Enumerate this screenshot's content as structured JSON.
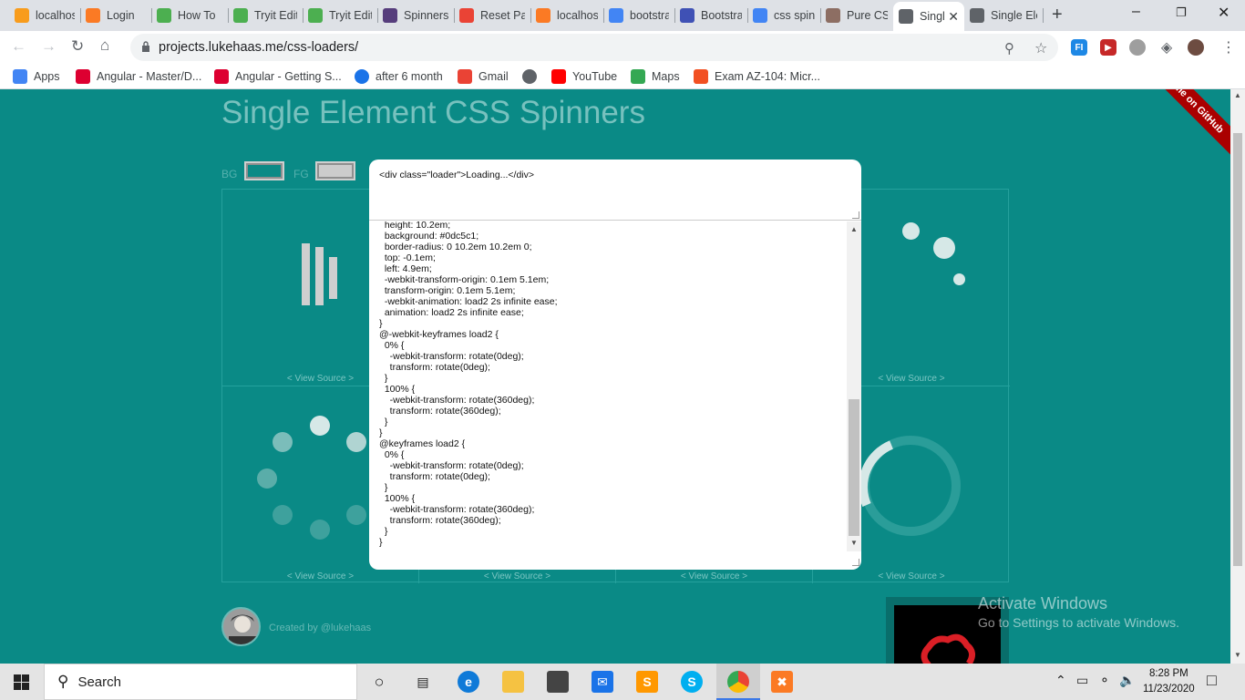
{
  "browser": {
    "tabs": [
      {
        "title": "localhost",
        "icon": "phpmyadmin-icon",
        "color": "#f89c1c"
      },
      {
        "title": "Login",
        "icon": "xampp-icon",
        "color": "#fb7a24"
      },
      {
        "title": "How To",
        "icon": "w3schools-icon",
        "color": "#4caf50"
      },
      {
        "title": "Tryit Editor",
        "icon": "w3schools-icon",
        "color": "#4caf50"
      },
      {
        "title": "Tryit Editor",
        "icon": "w3schools-icon",
        "color": "#4caf50"
      },
      {
        "title": "Spinners",
        "icon": "bootstrap-icon",
        "color": "#563d7c"
      },
      {
        "title": "Reset Password",
        "icon": "gmail-icon",
        "color": "#ea4335"
      },
      {
        "title": "localhost",
        "icon": "xampp-icon",
        "color": "#fb7a24"
      },
      {
        "title": "bootstrap",
        "icon": "google-icon",
        "color": "#4285f4"
      },
      {
        "title": "Bootstrap",
        "icon": "mdb-icon",
        "color": "#3f51b5"
      },
      {
        "title": "css spinner",
        "icon": "google-icon",
        "color": "#4285f4"
      },
      {
        "title": "Pure CSS",
        "icon": "codepen-icon",
        "color": "#8d6e63"
      },
      {
        "title": "Single",
        "icon": "globe-icon",
        "color": "#5f6368",
        "active": true
      },
      {
        "title": "Single Element",
        "icon": "globe-icon",
        "color": "#5f6368"
      }
    ],
    "address": "projects.lukehaas.me/css-loaders/",
    "bookmarks": [
      {
        "label": "Apps",
        "icon": "apps-grid-icon"
      },
      {
        "label": "Angular - Master/D...",
        "icon": "angular-icon"
      },
      {
        "label": "Angular - Getting S...",
        "icon": "angular-icon"
      },
      {
        "label": "after 6 month",
        "icon": "target-icon"
      },
      {
        "label": "Gmail",
        "icon": "gmail-icon"
      },
      {
        "label": "",
        "icon": "globe-icon"
      },
      {
        "label": "YouTube",
        "icon": "youtube-icon"
      },
      {
        "label": "Maps",
        "icon": "maps-icon"
      },
      {
        "label": "Exam AZ-104: Micr...",
        "icon": "microsoft-icon"
      }
    ]
  },
  "page": {
    "title": "Single Element CSS Spinners",
    "ribbon": "me on GitHub",
    "bg_label": "BG",
    "fg_label": "FG",
    "bg_color": "#0a8a86",
    "fg_color": "#cccccc",
    "view_source": "< View Source >",
    "credit": "Created by @lukehaas"
  },
  "modal": {
    "html_source": "<div class=\"loader\">Loading...</div>",
    "css_source": "  height: 10.2em;\n  background: #0dc5c1;\n  border-radius: 0 10.2em 10.2em 0;\n  top: -0.1em;\n  left: 4.9em;\n  -webkit-transform-origin: 0.1em 5.1em;\n  transform-origin: 0.1em 5.1em;\n  -webkit-animation: load2 2s infinite ease;\n  animation: load2 2s infinite ease;\n}\n@-webkit-keyframes load2 {\n  0% {\n    -webkit-transform: rotate(0deg);\n    transform: rotate(0deg);\n  }\n  100% {\n    -webkit-transform: rotate(360deg);\n    transform: rotate(360deg);\n  }\n}\n@keyframes load2 {\n  0% {\n    -webkit-transform: rotate(0deg);\n    transform: rotate(0deg);\n  }\n  100% {\n    -webkit-transform: rotate(360deg);\n    transform: rotate(360deg);\n  }\n}"
  },
  "watermark": {
    "line1": "Activate Windows",
    "line2": "Go to Settings to activate Windows."
  },
  "taskbar": {
    "search_label": "Search",
    "time": "8:28 PM",
    "date": "11/23/2020"
  }
}
